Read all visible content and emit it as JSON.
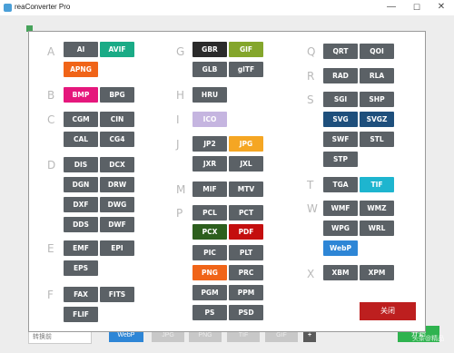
{
  "window": {
    "title": "reaConverter Pro",
    "minimize": "—",
    "maximize": "☐",
    "close": "✕"
  },
  "bottom_bar": {
    "input_text": "转换前",
    "webp": "WebP",
    "faded": [
      "JPG",
      "PNG",
      "TIF",
      "GIF"
    ],
    "plus": "+",
    "start": "开始"
  },
  "watermark": "头条@精品",
  "colors": {
    "default": "#5b6166",
    "dark": "#2b2b2b",
    "teal": "#1aab86",
    "orange": "#f06418",
    "pink": "#e5177c",
    "lavender": "#c5b5e0",
    "olive": "#84a62c",
    "gold": "#f5a623",
    "navy": "#1e4f7c",
    "cyan": "#1eb5cf",
    "blue": "#2e86d6",
    "red": "#c40e0e",
    "darkgreen": "#2d5f1e"
  },
  "letters": [
    "A",
    "B",
    "C",
    "D",
    "E",
    "F",
    "G",
    "H",
    "I",
    "J",
    "M",
    "P",
    "Q",
    "R",
    "S",
    "T",
    "W",
    "X"
  ],
  "formats": [
    {
      "label": "AI",
      "color": "default"
    },
    {
      "label": "AVIF",
      "color": "teal"
    },
    {
      "label": "APNG",
      "color": "orange"
    },
    {
      "label": "BMP",
      "color": "pink"
    },
    {
      "label": "BPG",
      "color": "default"
    },
    {
      "label": "CGM",
      "color": "default"
    },
    {
      "label": "CIN",
      "color": "default"
    },
    {
      "label": "CAL",
      "color": "default"
    },
    {
      "label": "CG4",
      "color": "default"
    },
    {
      "label": "DIS",
      "color": "default"
    },
    {
      "label": "DCX",
      "color": "default"
    },
    {
      "label": "DGN",
      "color": "default"
    },
    {
      "label": "DRW",
      "color": "default"
    },
    {
      "label": "DXF",
      "color": "default"
    },
    {
      "label": "DWG",
      "color": "default"
    },
    {
      "label": "DDS",
      "color": "default"
    },
    {
      "label": "DWF",
      "color": "default"
    },
    {
      "label": "EMF",
      "color": "default"
    },
    {
      "label": "EPI",
      "color": "default"
    },
    {
      "label": "EPS",
      "color": "default"
    },
    {
      "label": "FAX",
      "color": "default"
    },
    {
      "label": "FITS",
      "color": "default"
    },
    {
      "label": "FLIF",
      "color": "default"
    },
    {
      "label": "GBR",
      "color": "dark"
    },
    {
      "label": "GIF",
      "color": "olive"
    },
    {
      "label": "GLB",
      "color": "default"
    },
    {
      "label": "glTF",
      "color": "default"
    },
    {
      "label": "HRU",
      "color": "default"
    },
    {
      "label": "ICO",
      "color": "lavender"
    },
    {
      "label": "JP2",
      "color": "default"
    },
    {
      "label": "JPG",
      "color": "gold"
    },
    {
      "label": "JXR",
      "color": "default"
    },
    {
      "label": "JXL",
      "color": "default"
    },
    {
      "label": "MIF",
      "color": "default"
    },
    {
      "label": "MTV",
      "color": "default"
    },
    {
      "label": "PCL",
      "color": "default"
    },
    {
      "label": "PCT",
      "color": "default"
    },
    {
      "label": "PCX",
      "color": "darkgreen"
    },
    {
      "label": "PDF",
      "color": "red"
    },
    {
      "label": "PIC",
      "color": "default"
    },
    {
      "label": "PLT",
      "color": "default"
    },
    {
      "label": "PNG",
      "color": "orange"
    },
    {
      "label": "PRC",
      "color": "default"
    },
    {
      "label": "PGM",
      "color": "default"
    },
    {
      "label": "PPM",
      "color": "default"
    },
    {
      "label": "PS",
      "color": "default"
    },
    {
      "label": "PSD",
      "color": "default"
    },
    {
      "label": "QRT",
      "color": "default"
    },
    {
      "label": "QOI",
      "color": "default"
    },
    {
      "label": "RAD",
      "color": "default"
    },
    {
      "label": "RLA",
      "color": "default"
    },
    {
      "label": "SGI",
      "color": "default"
    },
    {
      "label": "SHP",
      "color": "default"
    },
    {
      "label": "SVG",
      "color": "navy"
    },
    {
      "label": "SVGZ",
      "color": "navy"
    },
    {
      "label": "SWF",
      "color": "default"
    },
    {
      "label": "STL",
      "color": "default"
    },
    {
      "label": "STP",
      "color": "default"
    },
    {
      "label": "TGA",
      "color": "default"
    },
    {
      "label": "TIF",
      "color": "cyan"
    },
    {
      "label": "WMF",
      "color": "default"
    },
    {
      "label": "WMZ",
      "color": "default"
    },
    {
      "label": "WPG",
      "color": "default"
    },
    {
      "label": "WRL",
      "color": "default"
    },
    {
      "label": "WebP",
      "color": "blue"
    },
    {
      "label": "XBM",
      "color": "default"
    },
    {
      "label": "XPM",
      "color": "default"
    }
  ],
  "dialog": {
    "close_label": "关闭"
  }
}
